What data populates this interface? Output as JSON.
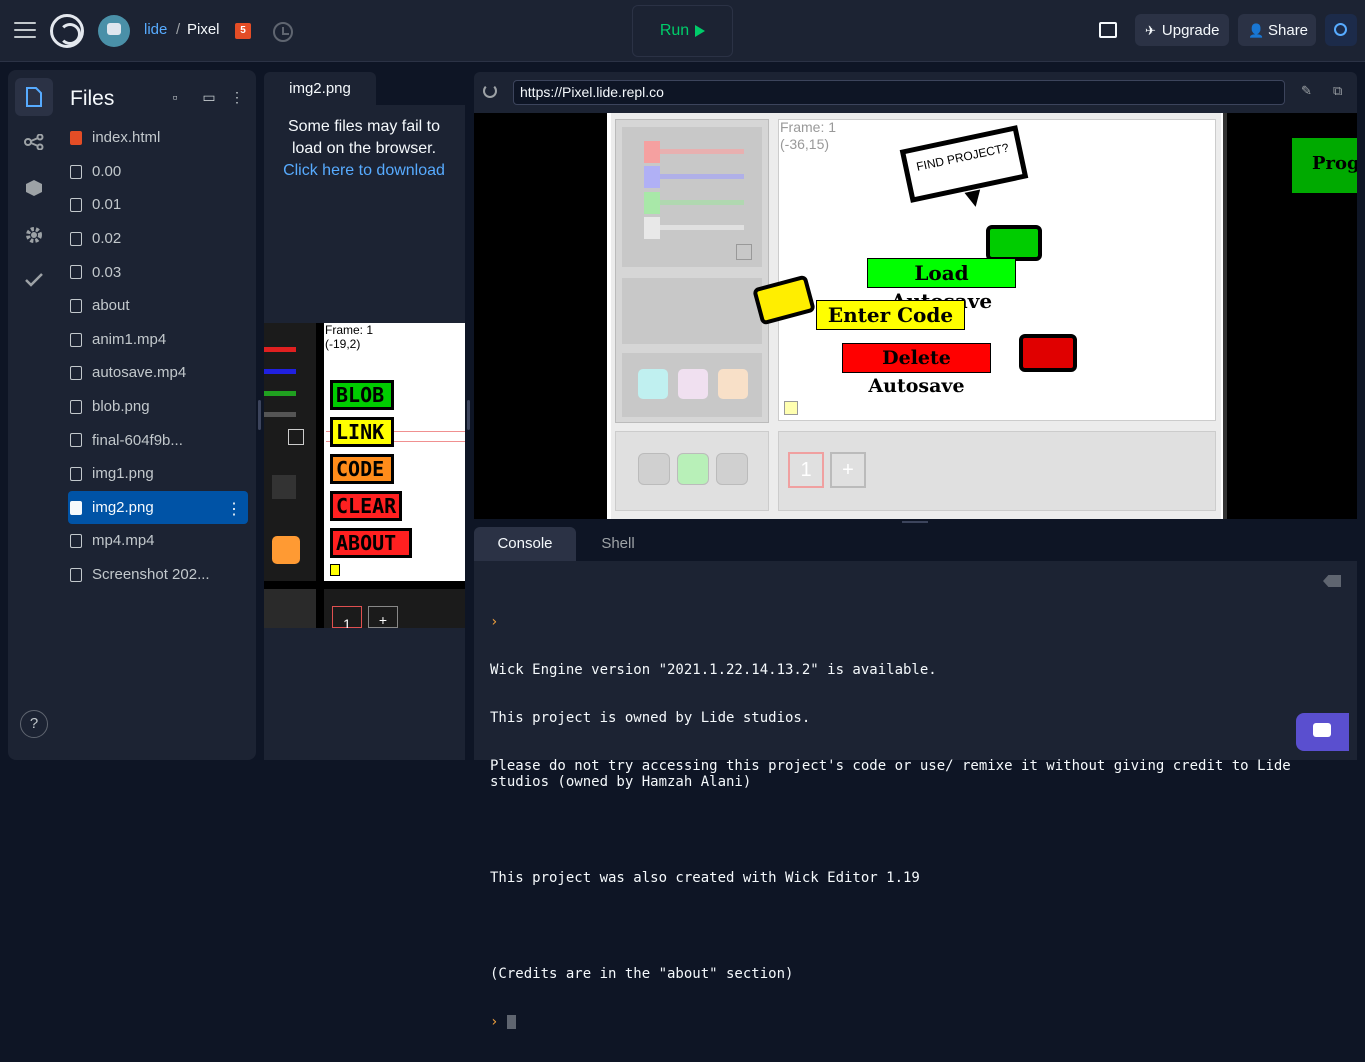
{
  "topbar": {
    "user": "lide",
    "separator": "/",
    "repl_name": "Pixel",
    "html5_badge": "5",
    "run_label": "Run",
    "upgrade_label": "Upgrade",
    "share_label": "Share"
  },
  "rail": {
    "help": "?"
  },
  "files": {
    "title": "Files",
    "items": [
      {
        "name": "index.html",
        "type": "html"
      },
      {
        "name": "0.00",
        "type": "file"
      },
      {
        "name": "0.01",
        "type": "file"
      },
      {
        "name": "0.02",
        "type": "file"
      },
      {
        "name": "0.03",
        "type": "file"
      },
      {
        "name": "about",
        "type": "file"
      },
      {
        "name": "anim1.mp4",
        "type": "file"
      },
      {
        "name": "autosave.mp4",
        "type": "file"
      },
      {
        "name": "blob.png",
        "type": "file"
      },
      {
        "name": "final-604f9b...",
        "type": "file"
      },
      {
        "name": "img1.png",
        "type": "file"
      },
      {
        "name": "img2.png",
        "type": "file",
        "selected": true
      },
      {
        "name": "mp4.mp4",
        "type": "file"
      },
      {
        "name": "Screenshot 202...",
        "type": "file"
      }
    ]
  },
  "image_pane": {
    "tab": "img2.png",
    "note": "Some files may fail to load on the browser.",
    "download_link": "Click here to download",
    "preview": {
      "frame_label": "Frame: 1",
      "coords": "(-19,2)",
      "menu": [
        "BLOB",
        "LINK",
        "CODE",
        "CLEAR",
        "ABOUT"
      ],
      "frame_number": "1",
      "add": "+"
    }
  },
  "webview": {
    "url": "https://Pixel.lide.repl.co",
    "game": {
      "frame_label": "Frame: 1",
      "coords": "(-36,15)",
      "speech_bubble": "FIND PROJECT?",
      "load_autosave": "Load Autosave",
      "enter_code": "Enter Code",
      "delete_autosave": "Delete Autosave",
      "side_banner": "Progre",
      "frame_number": "1",
      "add": "+"
    }
  },
  "console": {
    "tabs": [
      "Console",
      "Shell"
    ],
    "prompt_symbol": "›",
    "lines": [
      "Wick Engine version \"2021.1.22.14.13.2\" is available.",
      "This project is owned by Lide studios.",
      "Please do not try accessing this project's code or use/ remixe it without giving credit to Lide studios (owned by Hamzah Alani)",
      "",
      "This project was also created with Wick Editor 1.19",
      "",
      "(Credits are in the \"about\" section)"
    ]
  },
  "colors": {
    "accent": "#57abff",
    "run": "#00cc6a",
    "selected": "#0053a6",
    "game_green": "#00ff00",
    "game_yellow": "#ffff00",
    "game_red": "#ff0000"
  }
}
